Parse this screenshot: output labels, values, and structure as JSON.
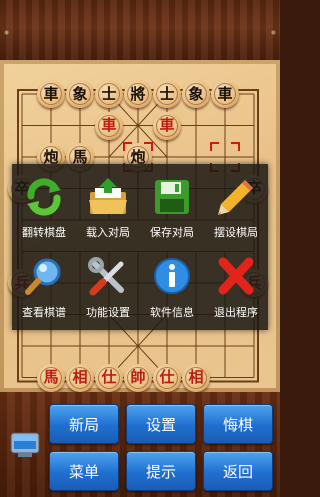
{
  "board": {
    "pieces": [
      {
        "text": "車",
        "color": "black",
        "col": 1,
        "row": 0
      },
      {
        "text": "象",
        "color": "black",
        "col": 2,
        "row": 0
      },
      {
        "text": "士",
        "color": "black",
        "col": 3,
        "row": 0
      },
      {
        "text": "將",
        "color": "black",
        "col": 4,
        "row": 0
      },
      {
        "text": "士",
        "color": "black",
        "col": 5,
        "row": 0
      },
      {
        "text": "象",
        "color": "black",
        "col": 6,
        "row": 0
      },
      {
        "text": "車",
        "color": "black",
        "col": 7,
        "row": 0
      },
      {
        "text": "車",
        "color": "red",
        "col": 3,
        "row": 1
      },
      {
        "text": "車",
        "color": "red",
        "col": 5,
        "row": 1
      },
      {
        "text": "炮",
        "color": "black",
        "col": 1,
        "row": 2
      },
      {
        "text": "馬",
        "color": "black",
        "col": 2,
        "row": 2
      },
      {
        "text": "炮",
        "color": "black",
        "col": 4,
        "row": 2
      },
      {
        "text": "卒",
        "color": "black",
        "col": 0,
        "row": 3
      },
      {
        "text": "卒",
        "color": "black",
        "col": 8,
        "row": 3
      },
      {
        "text": "兵",
        "color": "red",
        "col": 0,
        "row": 6
      },
      {
        "text": "兵",
        "color": "red",
        "col": 8,
        "row": 6
      },
      {
        "text": "馬",
        "color": "red",
        "col": 1,
        "row": 9
      },
      {
        "text": "相",
        "color": "red",
        "col": 2,
        "row": 9
      },
      {
        "text": "仕",
        "color": "red",
        "col": 3,
        "row": 9
      },
      {
        "text": "帥",
        "color": "red",
        "col": 4,
        "row": 9
      },
      {
        "text": "仕",
        "color": "red",
        "col": 5,
        "row": 9
      },
      {
        "text": "相",
        "color": "red",
        "col": 6,
        "row": 9
      }
    ],
    "selection_marks": [
      {
        "col": 4,
        "row": 2
      },
      {
        "col": 7,
        "row": 2
      }
    ]
  },
  "menu": {
    "items": [
      {
        "label": "翻转棋盘",
        "icon": "rotate-arrows-icon"
      },
      {
        "label": "载入对局",
        "icon": "folder-open-icon"
      },
      {
        "label": "保存对局",
        "icon": "floppy-disk-icon"
      },
      {
        "label": "摆设棋局",
        "icon": "pencil-icon"
      },
      {
        "label": "查看棋谱",
        "icon": "magnifier-icon"
      },
      {
        "label": "功能设置",
        "icon": "tools-icon"
      },
      {
        "label": "软件信息",
        "icon": "info-icon"
      },
      {
        "label": "退出程序",
        "icon": "red-x-icon"
      }
    ]
  },
  "toolbar": {
    "new_game": "新局",
    "settings": "设置",
    "undo": "悔棋",
    "menu": "菜单",
    "hint": "提示",
    "back": "返回",
    "screen_icon": "monitor-icon"
  },
  "colors": {
    "button_blue": "#2b7fe0",
    "red_piece_text": "#c21b10",
    "black_piece_text": "#1b1008",
    "board": "#ecc58d"
  }
}
